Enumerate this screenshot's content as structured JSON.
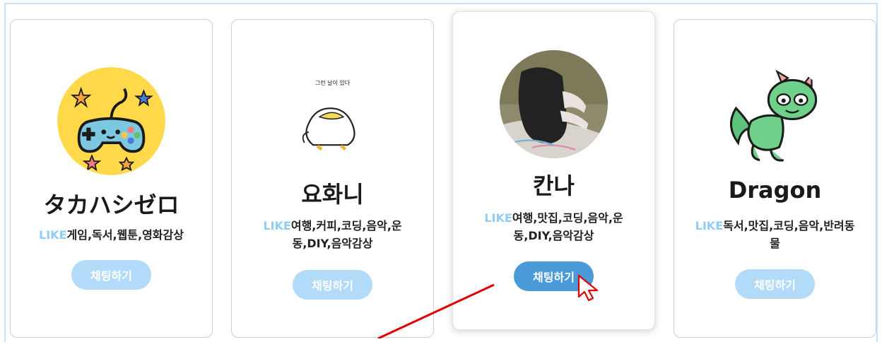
{
  "cards": [
    {
      "name": "タカハシゼロ",
      "likes_prefix": "LIKE",
      "likes_text": "게임,독서,웹툰,영화감상",
      "button_label": "채팅하기",
      "avatar_icon": "game-controller-icon"
    },
    {
      "name": "요화니",
      "likes_prefix": "LIKE",
      "likes_text": "여행,커피,코딩,음악,운동,DIY,음악감상",
      "button_label": "채팅하기",
      "avatar_icon": "duck-drawing-icon",
      "avatar_caption": "그런 날이 있다"
    },
    {
      "name": "칸나",
      "likes_prefix": "LIKE",
      "likes_text": "여행,맛집,코딩,음악,운동,DIY,음악감상",
      "button_label": "채팅하기",
      "avatar_icon": "person-photo-icon"
    },
    {
      "name": "Dragon",
      "likes_prefix": "LIKE",
      "likes_text": "독서,맛집,코딩,음악,반려동물",
      "button_label": "채팅하기",
      "avatar_icon": "dragon-icon"
    }
  ],
  "colors": {
    "accent": "#8fcdf6",
    "button": "#b1dbf8",
    "button_active": "#4a9ad8",
    "annotation_arrow": "#e00000"
  }
}
